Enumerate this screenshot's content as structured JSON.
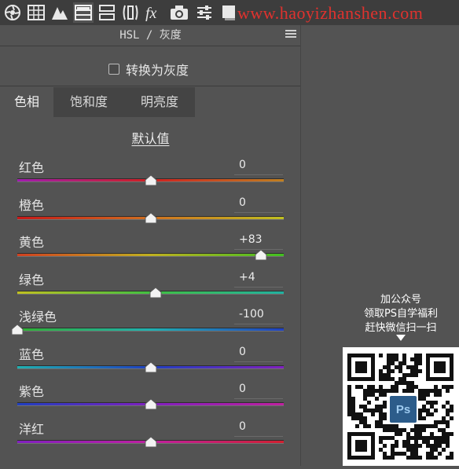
{
  "toolbar": {
    "icons": [
      "aperture-icon",
      "grid-icon",
      "mountain-icon",
      "hsl-panel-icon",
      "split-toning-icon",
      "lens-icon",
      "fx-icon",
      "camera-icon",
      "sliders-icon",
      "presets-icon"
    ],
    "active_icon": "hsl-panel-icon"
  },
  "watermark": {
    "text": "www.haoyizhanshen.com",
    "color": "#e0322e"
  },
  "panel": {
    "title": "HSL / 灰度",
    "convert_to_gray_label": "转换为灰度",
    "tabs": [
      {
        "label": "色相",
        "active": true
      },
      {
        "label": "饱和度",
        "active": false
      },
      {
        "label": "明亮度",
        "active": false
      }
    ],
    "default_label": "默认值",
    "sliders": [
      {
        "label": "红色",
        "value": "0",
        "position": 0.5,
        "gradient": [
          "#a01cb0",
          "#d02020",
          "#c08020"
        ]
      },
      {
        "label": "橙色",
        "value": "0",
        "position": 0.5,
        "gradient": [
          "#c81818",
          "#d07020",
          "#c0c020"
        ]
      },
      {
        "label": "黄色",
        "value": "+83",
        "position": 0.915,
        "gradient": [
          "#d04020",
          "#c0b020",
          "#40c020"
        ]
      },
      {
        "label": "绿色",
        "value": "+4",
        "position": 0.52,
        "gradient": [
          "#c0c020",
          "#40c040",
          "#20b0a0"
        ]
      },
      {
        "label": "浅绿色",
        "value": "-100",
        "position": 0.0,
        "gradient": [
          "#30b030",
          "#20b0b0",
          "#2040c0"
        ]
      },
      {
        "label": "蓝色",
        "value": "0",
        "position": 0.5,
        "gradient": [
          "#20b0b0",
          "#2040c0",
          "#8020c0"
        ]
      },
      {
        "label": "紫色",
        "value": "0",
        "position": 0.5,
        "gradient": [
          "#2040c0",
          "#8020c0",
          "#c020a0"
        ]
      },
      {
        "label": "洋红",
        "value": "0",
        "position": 0.5,
        "gradient": [
          "#8020c0",
          "#c020a0",
          "#d02030"
        ]
      }
    ]
  },
  "promo": {
    "lines": [
      "加公众号",
      "领取PS自学福利",
      "赶快微信扫一扫"
    ],
    "badge": "Ps"
  }
}
